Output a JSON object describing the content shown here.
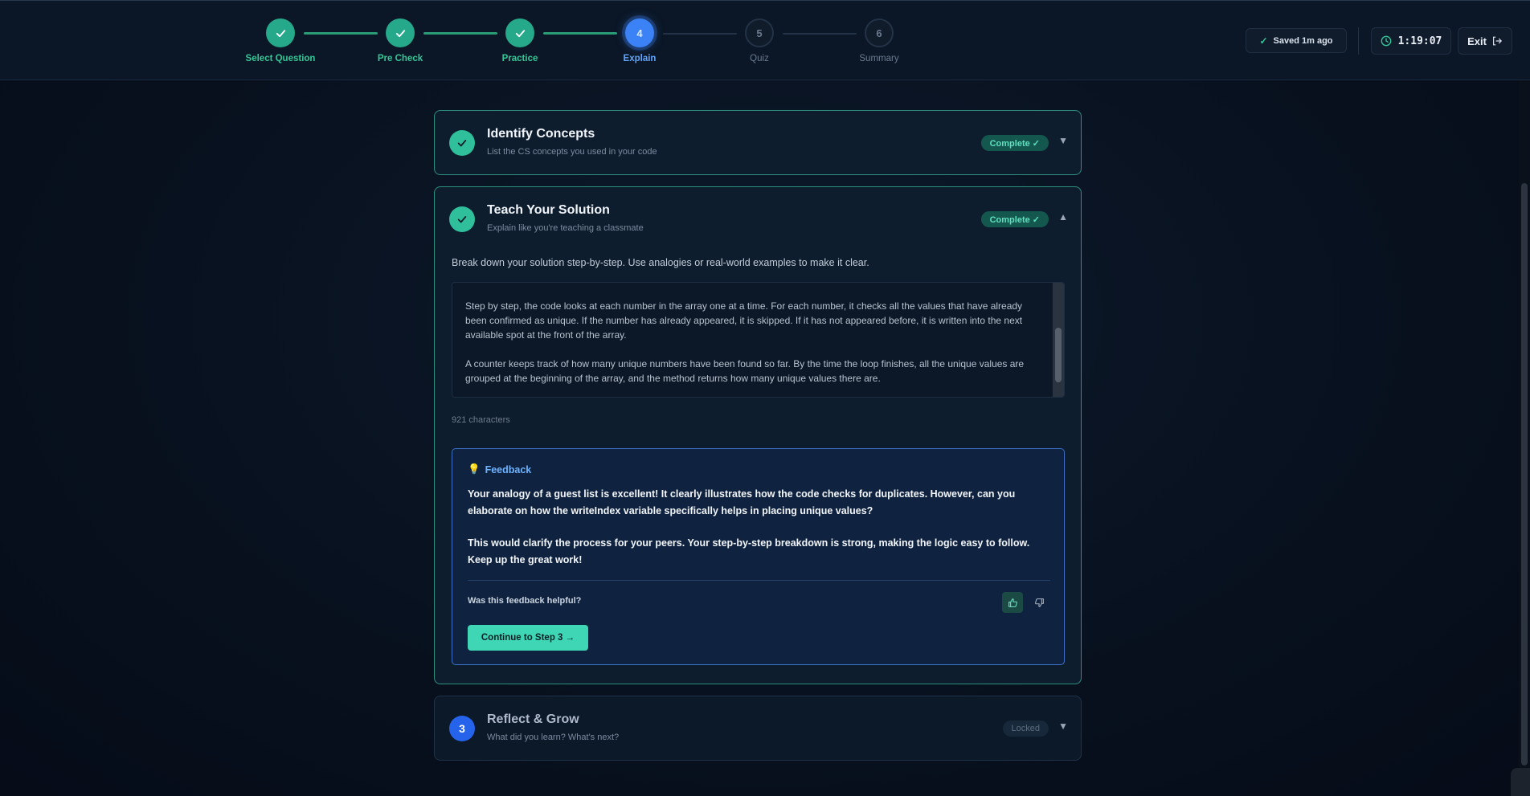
{
  "stepper": {
    "steps": [
      {
        "number": "1",
        "label": "Select Question",
        "state": "done"
      },
      {
        "number": "2",
        "label": "Pre Check",
        "state": "done"
      },
      {
        "number": "3",
        "label": "Practice",
        "state": "done"
      },
      {
        "number": "4",
        "label": "Explain",
        "state": "current"
      },
      {
        "number": "5",
        "label": "Quiz",
        "state": "future"
      },
      {
        "number": "6",
        "label": "Summary",
        "state": "future"
      }
    ]
  },
  "header": {
    "saved_label": "Saved 1m ago",
    "timer": "1:19:07",
    "exit_label": "Exit"
  },
  "cards": {
    "identify": {
      "title": "Identify Concepts",
      "subtitle": "List the CS concepts you used in your code",
      "badge": "Complete ✓"
    },
    "teach": {
      "title": "Teach Your Solution",
      "subtitle": "Explain like you're teaching a classmate",
      "badge": "Complete ✓",
      "prompt": "Break down your solution step-by-step. Use analogies or real-world examples to make it clear.",
      "answer_p1": "Step by step, the code looks at each number in the array one at a time. For each number, it checks all the values that have already been confirmed as unique. If the number has already appeared, it is skipped. If it has not appeared before, it is written into the next available spot at the front of the array.",
      "answer_p2": "A counter keeps track of how many unique numbers have been found so far. By the time the loop finishes, all the unique values are grouped at the beginning of the array, and the method returns how many unique values there are.",
      "char_count": "921 characters"
    },
    "reflect": {
      "number": "3",
      "title": "Reflect & Grow",
      "subtitle": "What did you learn? What's next?",
      "badge": "Locked"
    }
  },
  "feedback": {
    "heading": "Feedback",
    "paragraph1": "Your analogy of a guest list is excellent! It clearly illustrates how the code checks for duplicates. However, can you elaborate on how the writeIndex variable specifically helps in placing unique values?",
    "paragraph2": "This would clarify the process for your peers. Your step-by-step breakdown is strong, making the logic easy to follow. Keep up the great work!",
    "helpful_question": "Was this feedback helpful?",
    "continue_label": "Continue to Step 3 →"
  },
  "colors": {
    "accent_teal": "#3fd6b6",
    "done_green": "#26a98a",
    "current_blue": "#3b82f6",
    "card_border": "#2d8f7e"
  }
}
